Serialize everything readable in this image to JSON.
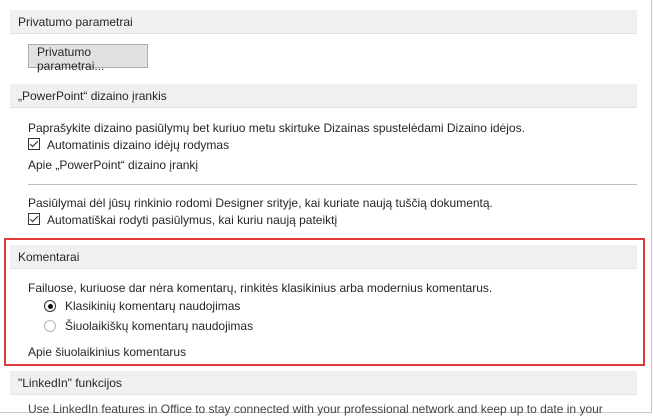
{
  "privacy": {
    "header": "Privatumo parametrai",
    "button_label": "Privatumo parametrai..."
  },
  "designer": {
    "header": "„PowerPoint“ dizaino įrankis",
    "description": "Paprašykite dizaino pasiūlymų bet kuriuo metu skirtuke Dizainas spustelėdami Dizaino idėjos.",
    "auto_show_label": "Automatinis dizaino idėjų rodymas",
    "about_link": "Apie „PowerPoint“ dizaino įrankį",
    "new_doc_description": "Pasiūlymai dėl jūsų rinkinio rodomi Designer srityje, kai kuriate naują tuščią dokumentą.",
    "auto_suggest_label": "Automatiškai rodyti pasiūlymus, kai kuriu naują pateiktį"
  },
  "comments": {
    "header": "Komentarai",
    "description": "Failuose, kuriuose dar nėra komentarų, rinkitės klasikinius arba modernius komentarus.",
    "option_classic": "Klasikinių komentarų naudojimas",
    "option_modern": "Šiuolaikiškų komentarų naudojimas",
    "about_link": "Apie šiuolaikinius komentarus",
    "highlight_color": "#e03b3b"
  },
  "linkedin": {
    "header": "\"LinkedIn\" funkcijos",
    "description": "Use LinkedIn features in Office to stay connected with your professional network and keep up to date in your"
  }
}
